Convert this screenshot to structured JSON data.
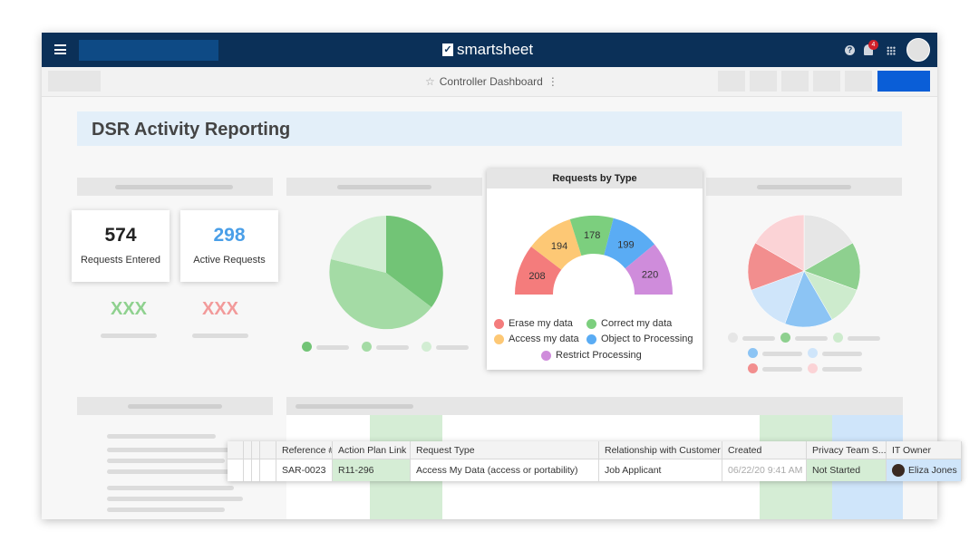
{
  "app": {
    "brand": "smartsheet",
    "notification_count": "4",
    "dashboard_title": "Controller Dashboard"
  },
  "header": {
    "title": "DSR Activity Reporting"
  },
  "metrics": [
    {
      "value": "574",
      "label": "Requests Entered",
      "color": "#222222"
    },
    {
      "value": "298",
      "label": "Active Requests",
      "color": "#4a9fe8"
    }
  ],
  "placeholders": [
    {
      "text": "XXX",
      "color": "#8fd18f"
    },
    {
      "text": "XXX",
      "color": "#f29a9a"
    }
  ],
  "chart_data": {
    "type": "pie",
    "subtype": "half-donut",
    "title": "Requests by Type",
    "categories": [
      "Erase my data",
      "Access my data",
      "Correct my data",
      "Object to Processing",
      "Restrict Processing"
    ],
    "values": [
      208,
      194,
      178,
      199,
      220
    ],
    "colors": [
      "#f47c7c",
      "#fdc875",
      "#7ccf7e",
      "#5aacf4",
      "#cf8cdb"
    ],
    "legend": "bottom"
  },
  "legend_order": [
    "Erase my data",
    "Correct my data",
    "Access my data",
    "Object to Processing",
    "Restrict Processing"
  ],
  "table": {
    "columns": [
      "Reference #",
      "Action Plan Link",
      "Request Type",
      "Relationship with Customer",
      "Created",
      "Privacy Team S...",
      "IT Owner"
    ],
    "row": [
      "SAR-0023",
      "R11-296",
      "Access My Data (access or portability)",
      "Job Applicant",
      "06/22/20 9:41 AM",
      "Not Started",
      "Eliza Jones"
    ]
  }
}
